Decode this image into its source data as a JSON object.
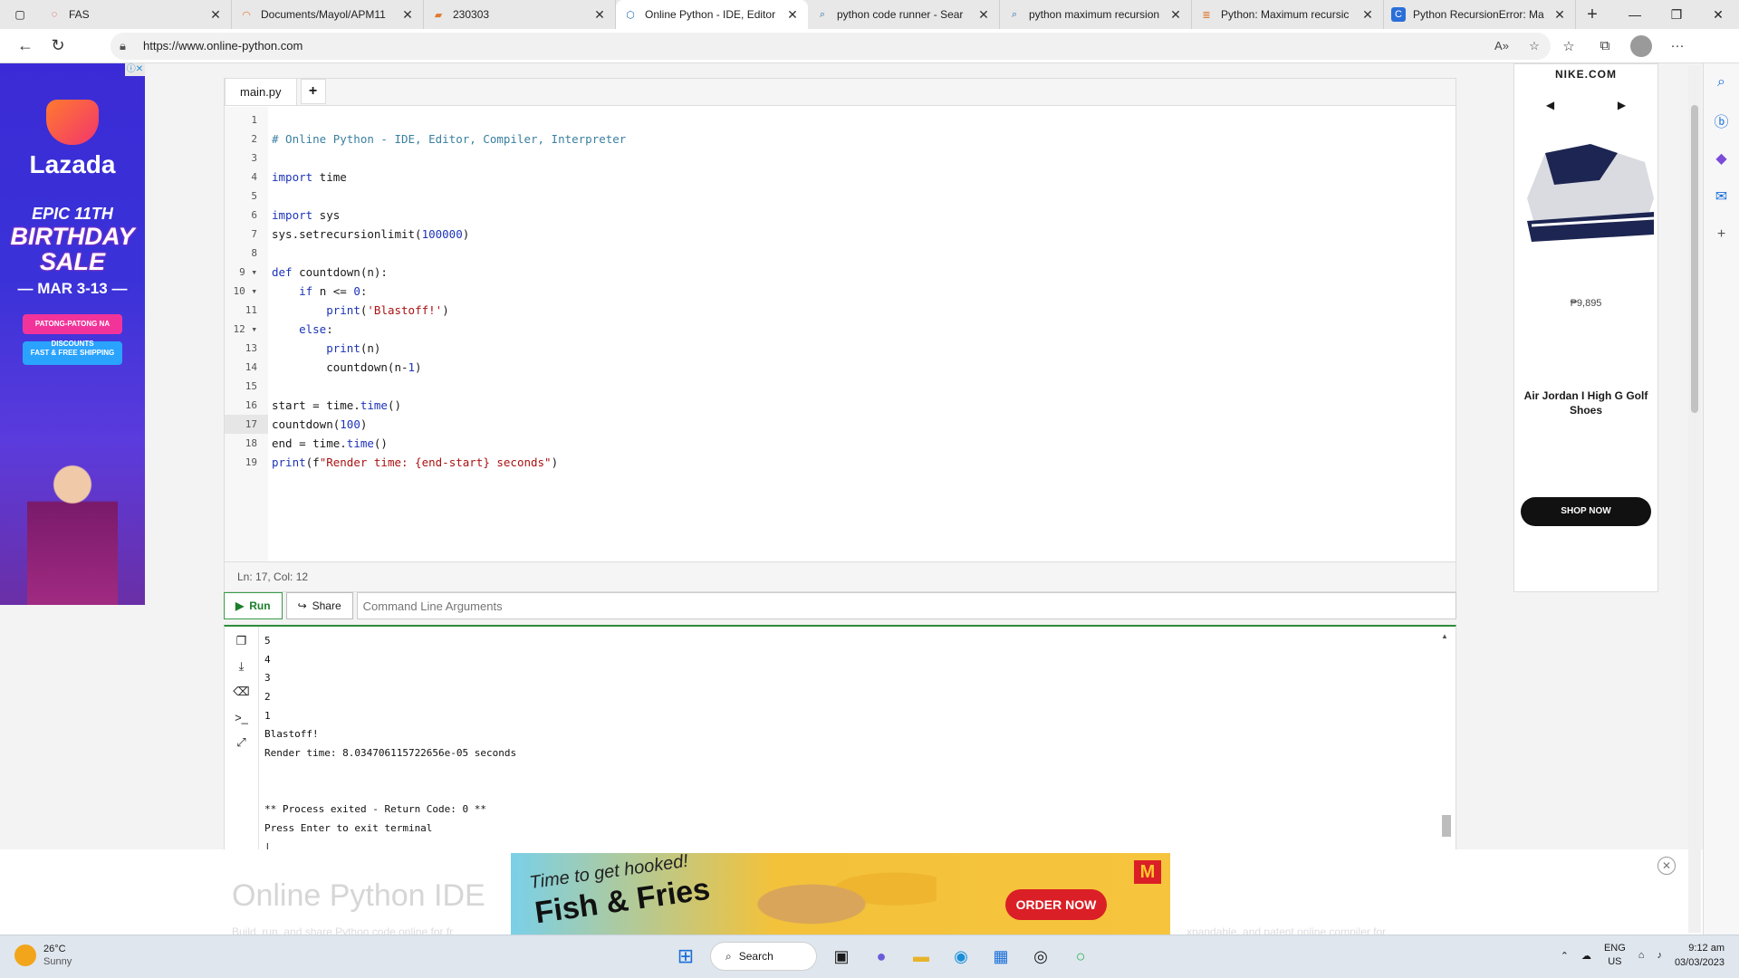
{
  "browser": {
    "tabs": [
      {
        "title": "FAS",
        "icon": "fas-icon"
      },
      {
        "title": "Documents/Mayol/APM11",
        "icon": "loading-icon"
      },
      {
        "title": "230303",
        "icon": "document-icon"
      },
      {
        "title": "Online Python - IDE, Editor",
        "icon": "python-icon",
        "active": true
      },
      {
        "title": "python code runner - Sear",
        "icon": "search-icon"
      },
      {
        "title": "python maximum recursion",
        "icon": "search-icon"
      },
      {
        "title": "Python: Maximum recursic",
        "icon": "stackoverflow-icon"
      },
      {
        "title": "Python RecursionError: Ma",
        "icon": "site-icon"
      }
    ],
    "url": "https://www.online-python.com"
  },
  "editor": {
    "file_tab": "main.py",
    "add_tab": "+",
    "line_numbers": [
      "1",
      "2",
      "3",
      "4",
      "5",
      "6",
      "7",
      "8",
      "9",
      "10",
      "11",
      "12",
      "13",
      "14",
      "15",
      "16",
      "17",
      "18",
      "19"
    ],
    "fold_markers": [
      "9",
      "10",
      "12"
    ],
    "status": "Ln: 17,  Col: 12"
  },
  "runbar": {
    "run_label": "Run",
    "share_label": "Share",
    "args_placeholder": "Command Line Arguments"
  },
  "terminal": {
    "lines": [
      "5",
      "4",
      "3",
      "2",
      "1",
      "Blastoff!",
      "Render time: 8.034706115722656e-05 seconds",
      "",
      "",
      "** Process exited - Return Code: 0 **",
      "Press Enter to exit terminal",
      "|"
    ]
  },
  "ads": {
    "lazada": {
      "brand": "Lazada",
      "line1": "EPIC 11TH",
      "line2": "BIRTHDAY",
      "line3": "SALE",
      "dates": "— MAR 3-13 —",
      "pill1": "PATONG-PATONG NA DISCOUNTS",
      "pill2": "FAST & FREE SHIPPING"
    },
    "nike": {
      "logo": "NIKE.COM",
      "price": "₱9,895",
      "product": "Air Jordan I High G Golf Shoes",
      "cta": "SHOP NOW"
    },
    "mcdonalds": {
      "line1": "Time to get hooked!",
      "line2": "Fish & Fries",
      "cta": "ORDER NOW"
    }
  },
  "page": {
    "heading": "Online Python IDE",
    "subtext_left": "Build, run, and share Python code online for fr",
    "subtext_right": "xpandable, and patent online compiler for"
  },
  "taskbar": {
    "temp": "26°C",
    "condition": "Sunny",
    "search_label": "Search",
    "lang_top": "ENG",
    "lang_bottom": "US",
    "time": "9:12 am",
    "date": "03/03/2023"
  },
  "colors": {
    "run_green": "#1a7f2a",
    "keyword_blue": "#1d33b8",
    "string_red": "#aa1111"
  }
}
